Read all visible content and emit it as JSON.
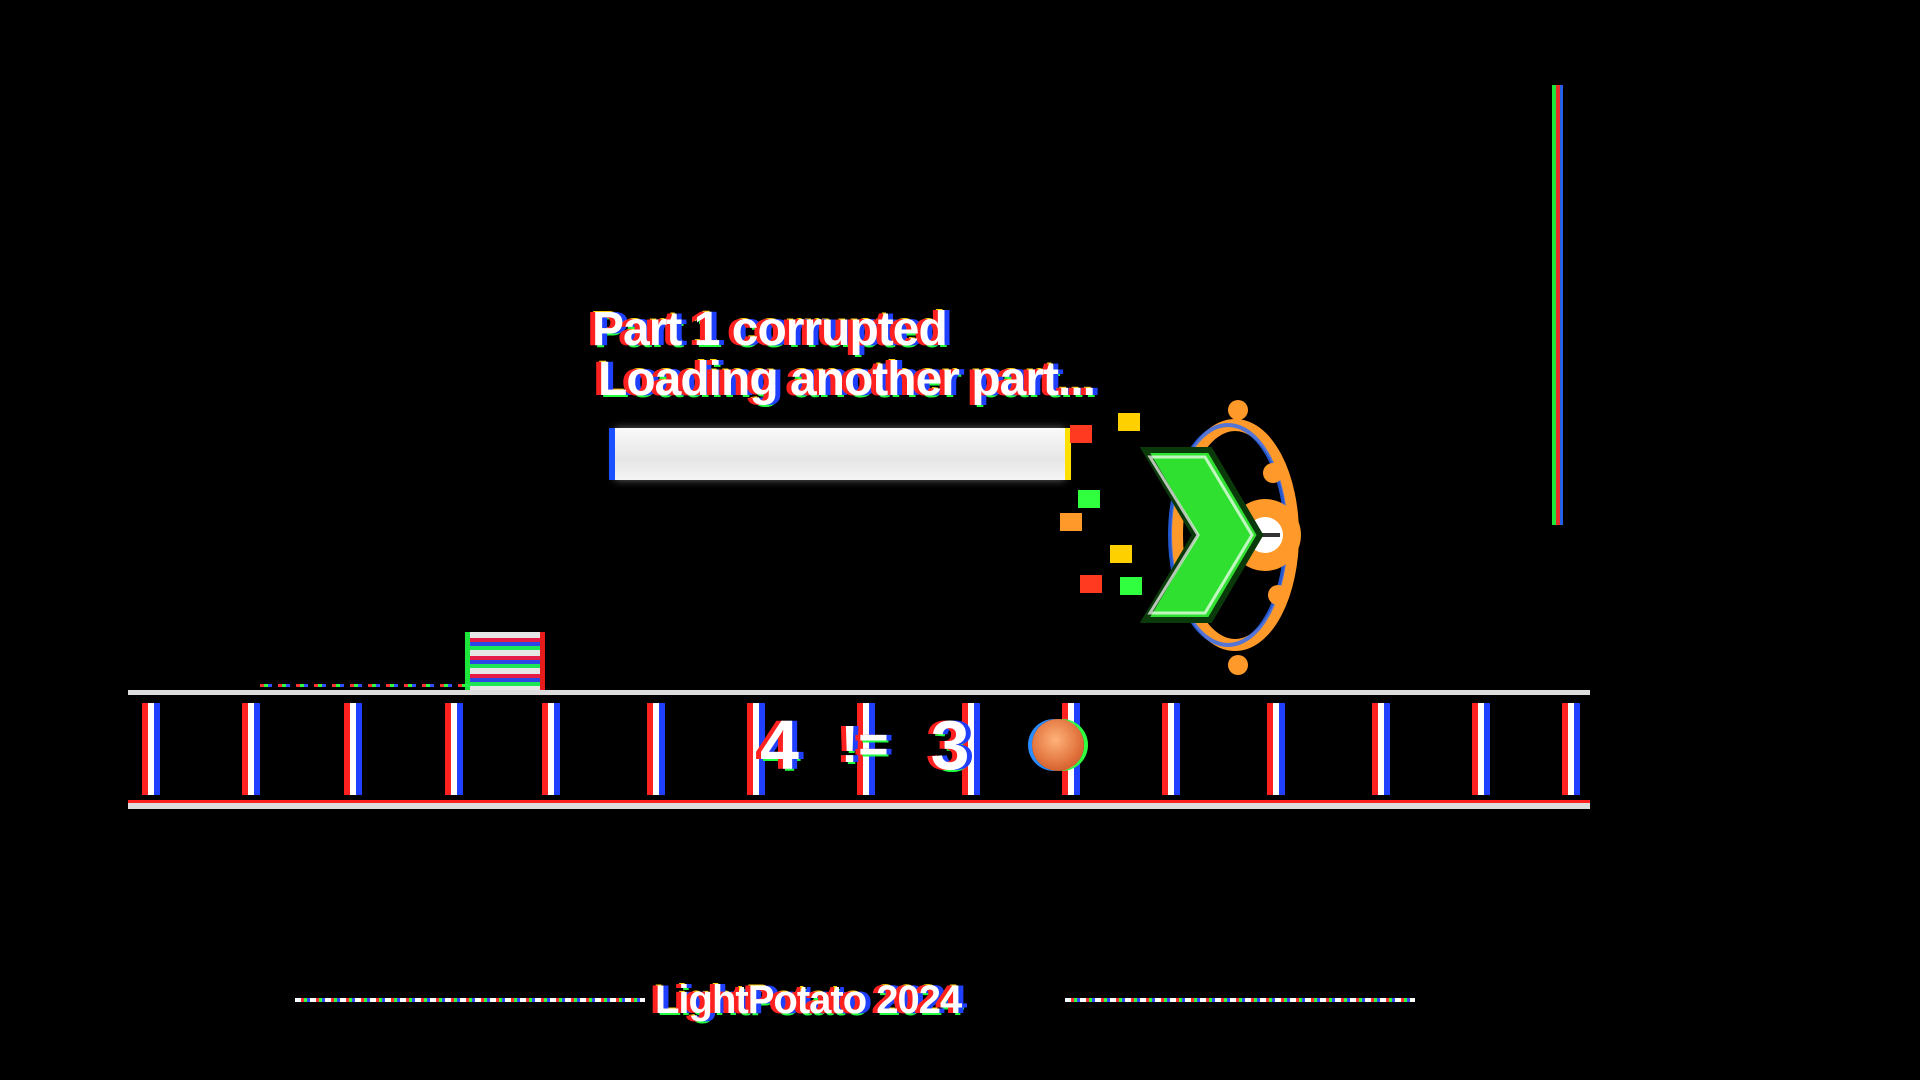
{
  "loading": {
    "line1": "Part 1 corrupted",
    "line2": "Loading another part...",
    "progress_percent": 100
  },
  "hud": {
    "left_value": "4",
    "operator": "!=",
    "right_value": "3",
    "coin_icon": "coin-icon"
  },
  "credit": "LightPotato 2024",
  "colors": {
    "background": "#000000",
    "text": "#ffffff",
    "chromatic_red": "#ff2020",
    "chromatic_blue": "#2040ff",
    "chromatic_green": "#20ff40",
    "character_green": "#30e030",
    "character_orange": "#ff9a2a"
  }
}
